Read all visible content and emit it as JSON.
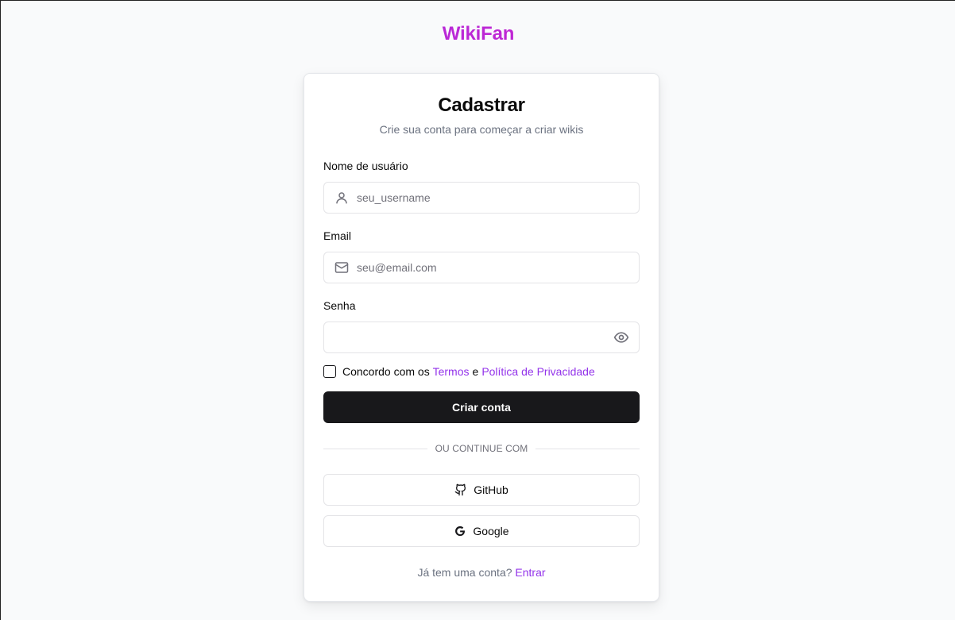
{
  "brand": {
    "name": "WikiFan"
  },
  "form": {
    "title": "Cadastrar",
    "subtitle": "Crie sua conta para começar a criar wikis",
    "username": {
      "label": "Nome de usuário",
      "placeholder": "seu_username",
      "value": "",
      "icon": "user-icon"
    },
    "email": {
      "label": "Email",
      "placeholder": "seu@email.com",
      "value": "",
      "icon": "mail-icon"
    },
    "password": {
      "label": "Senha",
      "placeholder": "",
      "value": "",
      "icon": "eye-icon"
    },
    "terms": {
      "checked": false,
      "prefix": "Concordo com os",
      "terms_link": "Termos",
      "joiner": "e",
      "privacy_link": "Política de Privacidade"
    },
    "submit_label": "Criar conta",
    "divider_label": "OU CONTINUE COM",
    "github_label": "GitHub",
    "google_label": "Google",
    "footer": {
      "prompt": "Já tem uma conta?",
      "login_link": "Entrar"
    }
  },
  "colors": {
    "accent": "#9333ea",
    "brand_gradient_start": "#9333ea",
    "brand_gradient_end": "#db2777",
    "primary_button": "#18181b",
    "background": "#f9fafb"
  }
}
